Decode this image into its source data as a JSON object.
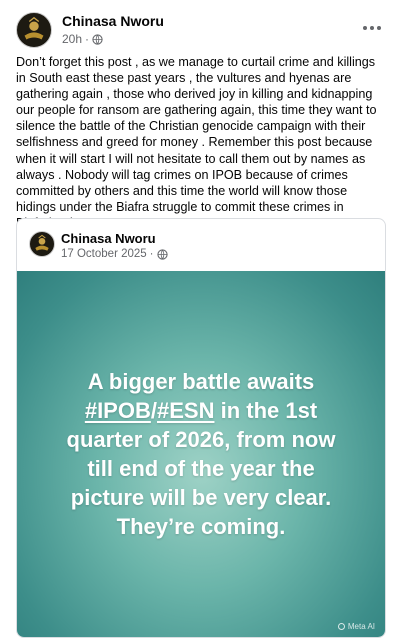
{
  "post": {
    "author": "Chinasa Nworu",
    "time": "20h",
    "separator": "·",
    "privacy_icon": "globe-icon",
    "text": "Don’t forget this post , as we manage to curtail crime and killings in South east  these past years , the vultures  and hyenas are gathering again , those who derived joy in killing and kidnapping our people for ransom are gathering again, this time they want to silence the battle of the Christian genocide campaign with their selfishness and greed for money . Remember this post because when it will start I will not hesitate to call them out by names as always . Nobody will tag crimes on IPOB because of crimes committed by  others and this time the world will know those hidings under the Biafra struggle  to commit these crimes  in Biafraland .",
    "more_icon": "more-options-icon"
  },
  "shared": {
    "author": "Chinasa Nworu",
    "date": "17 October 2025",
    "separator": "·",
    "privacy_icon": "globe-icon",
    "graphic": {
      "line1": "A bigger battle awaits",
      "tag1": "#IPOB",
      "slash": "/",
      "tag2": "#ESN",
      "line2_rest": " in the 1st",
      "line3": "quarter of 2026, from now",
      "line4": "till end of the year the",
      "line5": "picture will be very clear.",
      "line6": "They’re coming.",
      "watermark": "Meta AI",
      "bg_color": "#5fae a4"
    }
  },
  "colors": {
    "text_primary": "#050505",
    "text_secondary": "#65676b",
    "border": "#dadde1",
    "graphic_bg": "#5fb0a6"
  }
}
